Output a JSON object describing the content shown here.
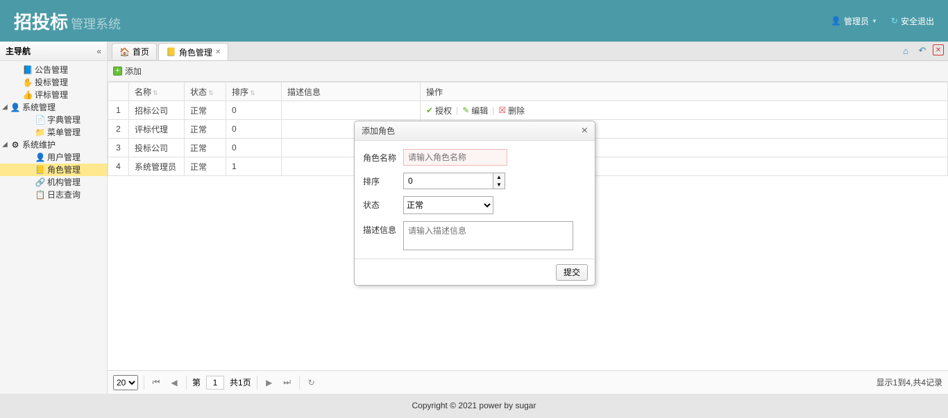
{
  "header": {
    "logo_main": "招投标",
    "logo_sub": "管理系统",
    "admin_label": "管理员",
    "logout_label": "安全退出"
  },
  "sidebar": {
    "title": "主导航",
    "items": [
      {
        "icon": "📘",
        "label": "公告管理",
        "indent": 1
      },
      {
        "icon": "✋",
        "label": "投标管理",
        "indent": 1
      },
      {
        "icon": "👍",
        "label": "评标管理",
        "indent": 1
      },
      {
        "toggle": "◢",
        "icon": "👤",
        "label": "系统管理",
        "indent": 0
      },
      {
        "icon": "📄",
        "label": "字典管理",
        "indent": 2
      },
      {
        "icon": "📁",
        "label": "菜单管理",
        "indent": 2
      },
      {
        "toggle": "◢",
        "icon": "⚙",
        "label": "系统维护",
        "indent": 0
      },
      {
        "icon": "👤",
        "label": "用户管理",
        "indent": 2
      },
      {
        "icon": "📒",
        "label": "角色管理",
        "indent": 2,
        "selected": true
      },
      {
        "icon": "🔗",
        "label": "机构管理",
        "indent": 2
      },
      {
        "icon": "📋",
        "label": "日志查询",
        "indent": 2
      }
    ]
  },
  "tabs": {
    "list": [
      {
        "icon": "🏠",
        "label": "首页",
        "closable": false
      },
      {
        "icon": "📒",
        "label": "角色管理",
        "closable": true,
        "active": true
      }
    ]
  },
  "toolbar": {
    "add_label": "添加"
  },
  "grid": {
    "headers": [
      "",
      "名称",
      "状态",
      "排序",
      "描述信息",
      "操作"
    ],
    "rows": [
      {
        "idx": "1",
        "name": "招标公司",
        "status": "正常",
        "sort": "0",
        "desc": "",
        "showActions": true
      },
      {
        "idx": "2",
        "name": "评标代理",
        "status": "正常",
        "sort": "0",
        "desc": ""
      },
      {
        "idx": "3",
        "name": "投标公司",
        "status": "正常",
        "sort": "0",
        "desc": ""
      },
      {
        "idx": "4",
        "name": "系统管理员",
        "status": "正常",
        "sort": "1",
        "desc": ""
      }
    ],
    "actions": {
      "auth": "授权",
      "edit": "编辑",
      "del": "删除"
    }
  },
  "pager": {
    "page_size": "20",
    "page_prefix": "第",
    "page_value": "1",
    "total_pages": "共1页",
    "info": "显示1到4,共4记录"
  },
  "dialog": {
    "title": "添加角色",
    "fields": {
      "name_label": "角色名称",
      "name_placeholder": "请输入角色名称",
      "sort_label": "排序",
      "sort_value": "0",
      "status_label": "状态",
      "status_value": "正常",
      "desc_label": "描述信息",
      "desc_placeholder": "请输入描述信息"
    },
    "submit": "提交"
  },
  "footer": "Copyright © 2021 power by sugar"
}
